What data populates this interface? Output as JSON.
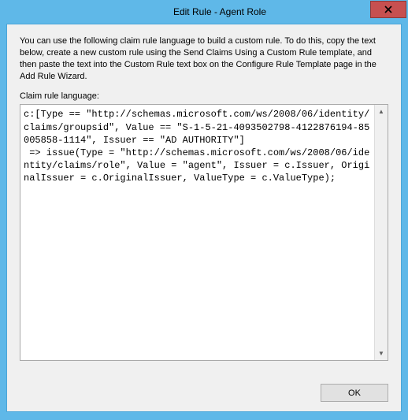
{
  "titlebar": {
    "title": "Edit Rule - Agent Role"
  },
  "body": {
    "instructions": "You can use the following claim rule language to build a custom rule. To do this, copy the text below, create a new custom rule using the Send Claims Using a Custom Rule template, and then paste the text into the Custom Rule text box on the Configure Rule Template page in the Add Rule Wizard.",
    "field_label": "Claim rule language:",
    "rule_text": "c:[Type == \"http://schemas.microsoft.com/ws/2008/06/identity/claims/groupsid\", Value == \"S-1-5-21-4093502798-4122876194-85005858-1114\", Issuer == \"AD AUTHORITY\"]\n => issue(Type = \"http://schemas.microsoft.com/ws/2008/06/identity/claims/role\", Value = \"agent\", Issuer = c.Issuer, OriginalIssuer = c.OriginalIssuer, ValueType = c.ValueType);"
  },
  "buttons": {
    "ok": "OK"
  }
}
